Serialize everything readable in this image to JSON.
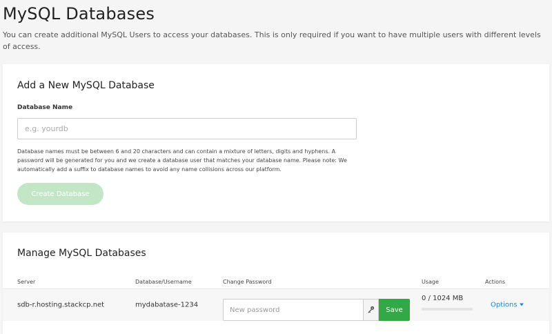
{
  "page": {
    "title": "MySQL Databases",
    "description": "You can create additional MySQL Users to access your databases. This is only required if you want to have multiple users with different levels of access."
  },
  "add_card": {
    "title": "Add a New MySQL Database",
    "field_label": "Database Name",
    "field_value": "",
    "field_placeholder": "e.g. yourdb",
    "help_text": "Database names must be between 6 and 20 characters and can contain a mixture of letters, digits and hyphens. A password will be generated for you and we create a database user that matches your database name. Please note: We automatically add a suffix to database names to avoid any name collisions across our platform.",
    "create_button": "Create Database",
    "create_button_color": "#c2e6c6"
  },
  "manage_card": {
    "title": "Manage MySQL Databases",
    "columns": [
      "Server",
      "Database/Username",
      "Change Password",
      "Usage",
      "Actions"
    ],
    "rows": [
      {
        "server": "sdb-r.hosting.stackcp.net",
        "database": "mydabatase-1234",
        "password_value": "",
        "password_placeholder": "New password",
        "key_icon": "key-icon",
        "save_label": "Save",
        "usage": "0 / 1024 MB",
        "usage_fraction": 0,
        "actions_label": "Options"
      }
    ]
  },
  "colors": {
    "accent_green": "#33a846",
    "link_blue": "#1e88c8"
  }
}
